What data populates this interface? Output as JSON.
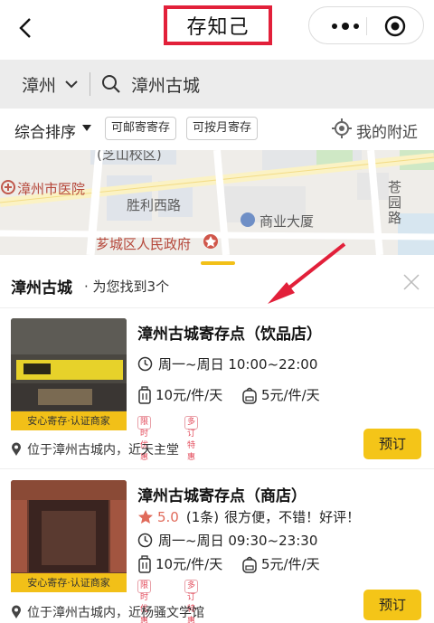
{
  "header": {
    "title": "存知己"
  },
  "search": {
    "city": "漳州",
    "query": "漳州古城"
  },
  "filters": {
    "sort_label": "综合排序",
    "chip1": "可邮寄寄存",
    "chip2": "可按月寄存",
    "nearby": "我的附近"
  },
  "map": {
    "labels": [
      "漳州市医院",
      "胜利西路",
      "商业大厦",
      "芗城区人民政府",
      "苍",
      "园",
      "路",
      "(芝山校区)"
    ]
  },
  "results": {
    "location": "漳州古城",
    "count_text": "· 为您找到3个"
  },
  "listings": [
    {
      "title": "漳州古城寄存点（饮品店）",
      "hours": "周一~周日 10:00~22:00",
      "price_luggage": "10元/件/天",
      "price_bag": "5元/件/天",
      "tags": [
        "限时优惠",
        "多订特惠"
      ],
      "badge": "安心寄存·认证商家",
      "location": "位于漳州古城内，近天主堂",
      "book_label": "预订"
    },
    {
      "title": "漳州古城寄存点（商店）",
      "rating": "5.0",
      "review_count": "(1条)",
      "review": "很方便，不错！好评！",
      "hours": "周一~周日 09:30~23:30",
      "price_luggage": "10元/件/天",
      "price_bag": "5元/件/天",
      "tags": [
        "限时优惠",
        "多订特惠"
      ],
      "badge": "安心寄存·认证商家",
      "location": "位于漳州古城内，近杨骚文学馆",
      "book_label": "预订"
    }
  ],
  "colors": {
    "accent": "#f4c518",
    "highlight_border": "#e2203a",
    "tag_red": "#e34c5c",
    "star": "#e06a5a"
  }
}
